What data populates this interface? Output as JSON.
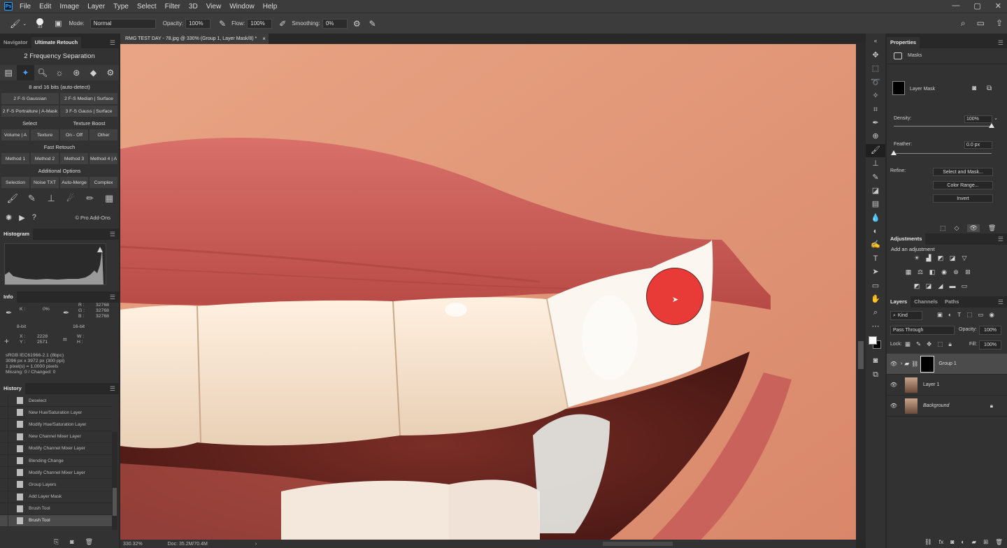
{
  "app": {
    "logo": "Ps",
    "menus": [
      "File",
      "Edit",
      "Image",
      "Layer",
      "Type",
      "Select",
      "Filter",
      "3D",
      "View",
      "Window",
      "Help"
    ],
    "window_controls": [
      "—",
      "▢",
      "✕"
    ]
  },
  "options_bar": {
    "brush_size": "33",
    "mode_label": "Mode:",
    "mode_value": "Normal",
    "opacity_label": "Opacity:",
    "opacity_value": "100%",
    "flow_label": "Flow:",
    "flow_value": "100%",
    "smoothing_label": "Smoothing:",
    "smoothing_value": "0%"
  },
  "left": {
    "tabs": [
      "Navigator",
      "Ultimate Retouch"
    ],
    "ur_title": "2 Frequency Separation",
    "bits_label": "8 and 16 bits (auto-detect)",
    "fs_row1": [
      "2 F-S Gaussian",
      "2 F-S Median | Surface"
    ],
    "fs_row2": [
      "2 F-S Portraiture | A-Mask",
      "3 F-S Gauss | Surface"
    ],
    "select_header": "Select",
    "texture_boost_header": "Texture Boost",
    "select_row": [
      "Volume | A",
      "Texture",
      "On - Off",
      "Other"
    ],
    "fast_retouch": "Fast Retouch",
    "method_row": [
      "Method 1",
      "Method 2",
      "Method 3",
      "Method 4 | A"
    ],
    "additional_options": "Additional Options",
    "additional_row": [
      "Selection",
      "Noise TXT",
      "Auto-Merge",
      "Complex"
    ],
    "pro_addons": "© Pro Add-Ons",
    "histogram_title": "Histogram",
    "info_title": "Info",
    "info": {
      "k_label": "K :",
      "k_value": "0%",
      "r_label": "R :",
      "r_value": "32768",
      "g_label": "G :",
      "g_value": "32768",
      "b_label": "B :",
      "b_value": "32768",
      "bit8": "8-bit",
      "bit16": "16-bit",
      "x_label": "X :",
      "x_value": "2228",
      "y_label": "Y :",
      "y_value": "2571",
      "w_label": "W :",
      "h_label": "H :",
      "line1": "sRGB IEC61966-2.1 (8bpc)",
      "line2": "3096 px x 3972 px (300 ppi)",
      "line3": "1 pixel(s) = 1.0000 pixels",
      "line4": "Missing: 0 / Changed: 0"
    },
    "history_title": "History",
    "history": [
      "Deselect",
      "New Hue/Saturation Layer",
      "Modify Hue/Saturation Layer",
      "New Channel Mixer Layer",
      "Modify Channel Mixer Layer",
      "Blending Change",
      "Modify Channel Mixer Layer",
      "Group Layers",
      "Add Layer Mask",
      "Brush Tool",
      "Brush Tool"
    ]
  },
  "document": {
    "tab_title": "RMG TEST DAY - 78.jpg @ 330% (Group 1, Layer Mask/8) *",
    "zoom": "330.32%",
    "doc_info": "Doc: 35.2M/70.4M"
  },
  "properties": {
    "title": "Properties",
    "masks_label": "Masks",
    "layer_mask_label": "Layer Mask",
    "density_label": "Density:",
    "density_value": "100%",
    "density_level": 1.0,
    "feather_label": "Feather:",
    "feather_value": "0.0 px",
    "feather_level": 0.0,
    "refine_label": "Refine:",
    "select_and_mask": "Select and Mask...",
    "color_range": "Color Range...",
    "invert": "Invert"
  },
  "adjustments": {
    "title": "Adjustments",
    "subtitle": "Add an adjustment"
  },
  "layers": {
    "tabs": [
      "Layers",
      "Channels",
      "Paths"
    ],
    "kind_value": "Kind",
    "blend_mode": "Pass Through",
    "opacity_label": "Opacity:",
    "opacity_value": "100%",
    "lock_label": "Lock:",
    "fill_label": "Fill:",
    "fill_value": "100%",
    "items": [
      {
        "name": "Group 1"
      },
      {
        "name": "Layer 1"
      },
      {
        "name": "Background"
      }
    ]
  },
  "colors": {
    "brush_cursor": "#e8322e",
    "accent": "#4aa3ff"
  }
}
